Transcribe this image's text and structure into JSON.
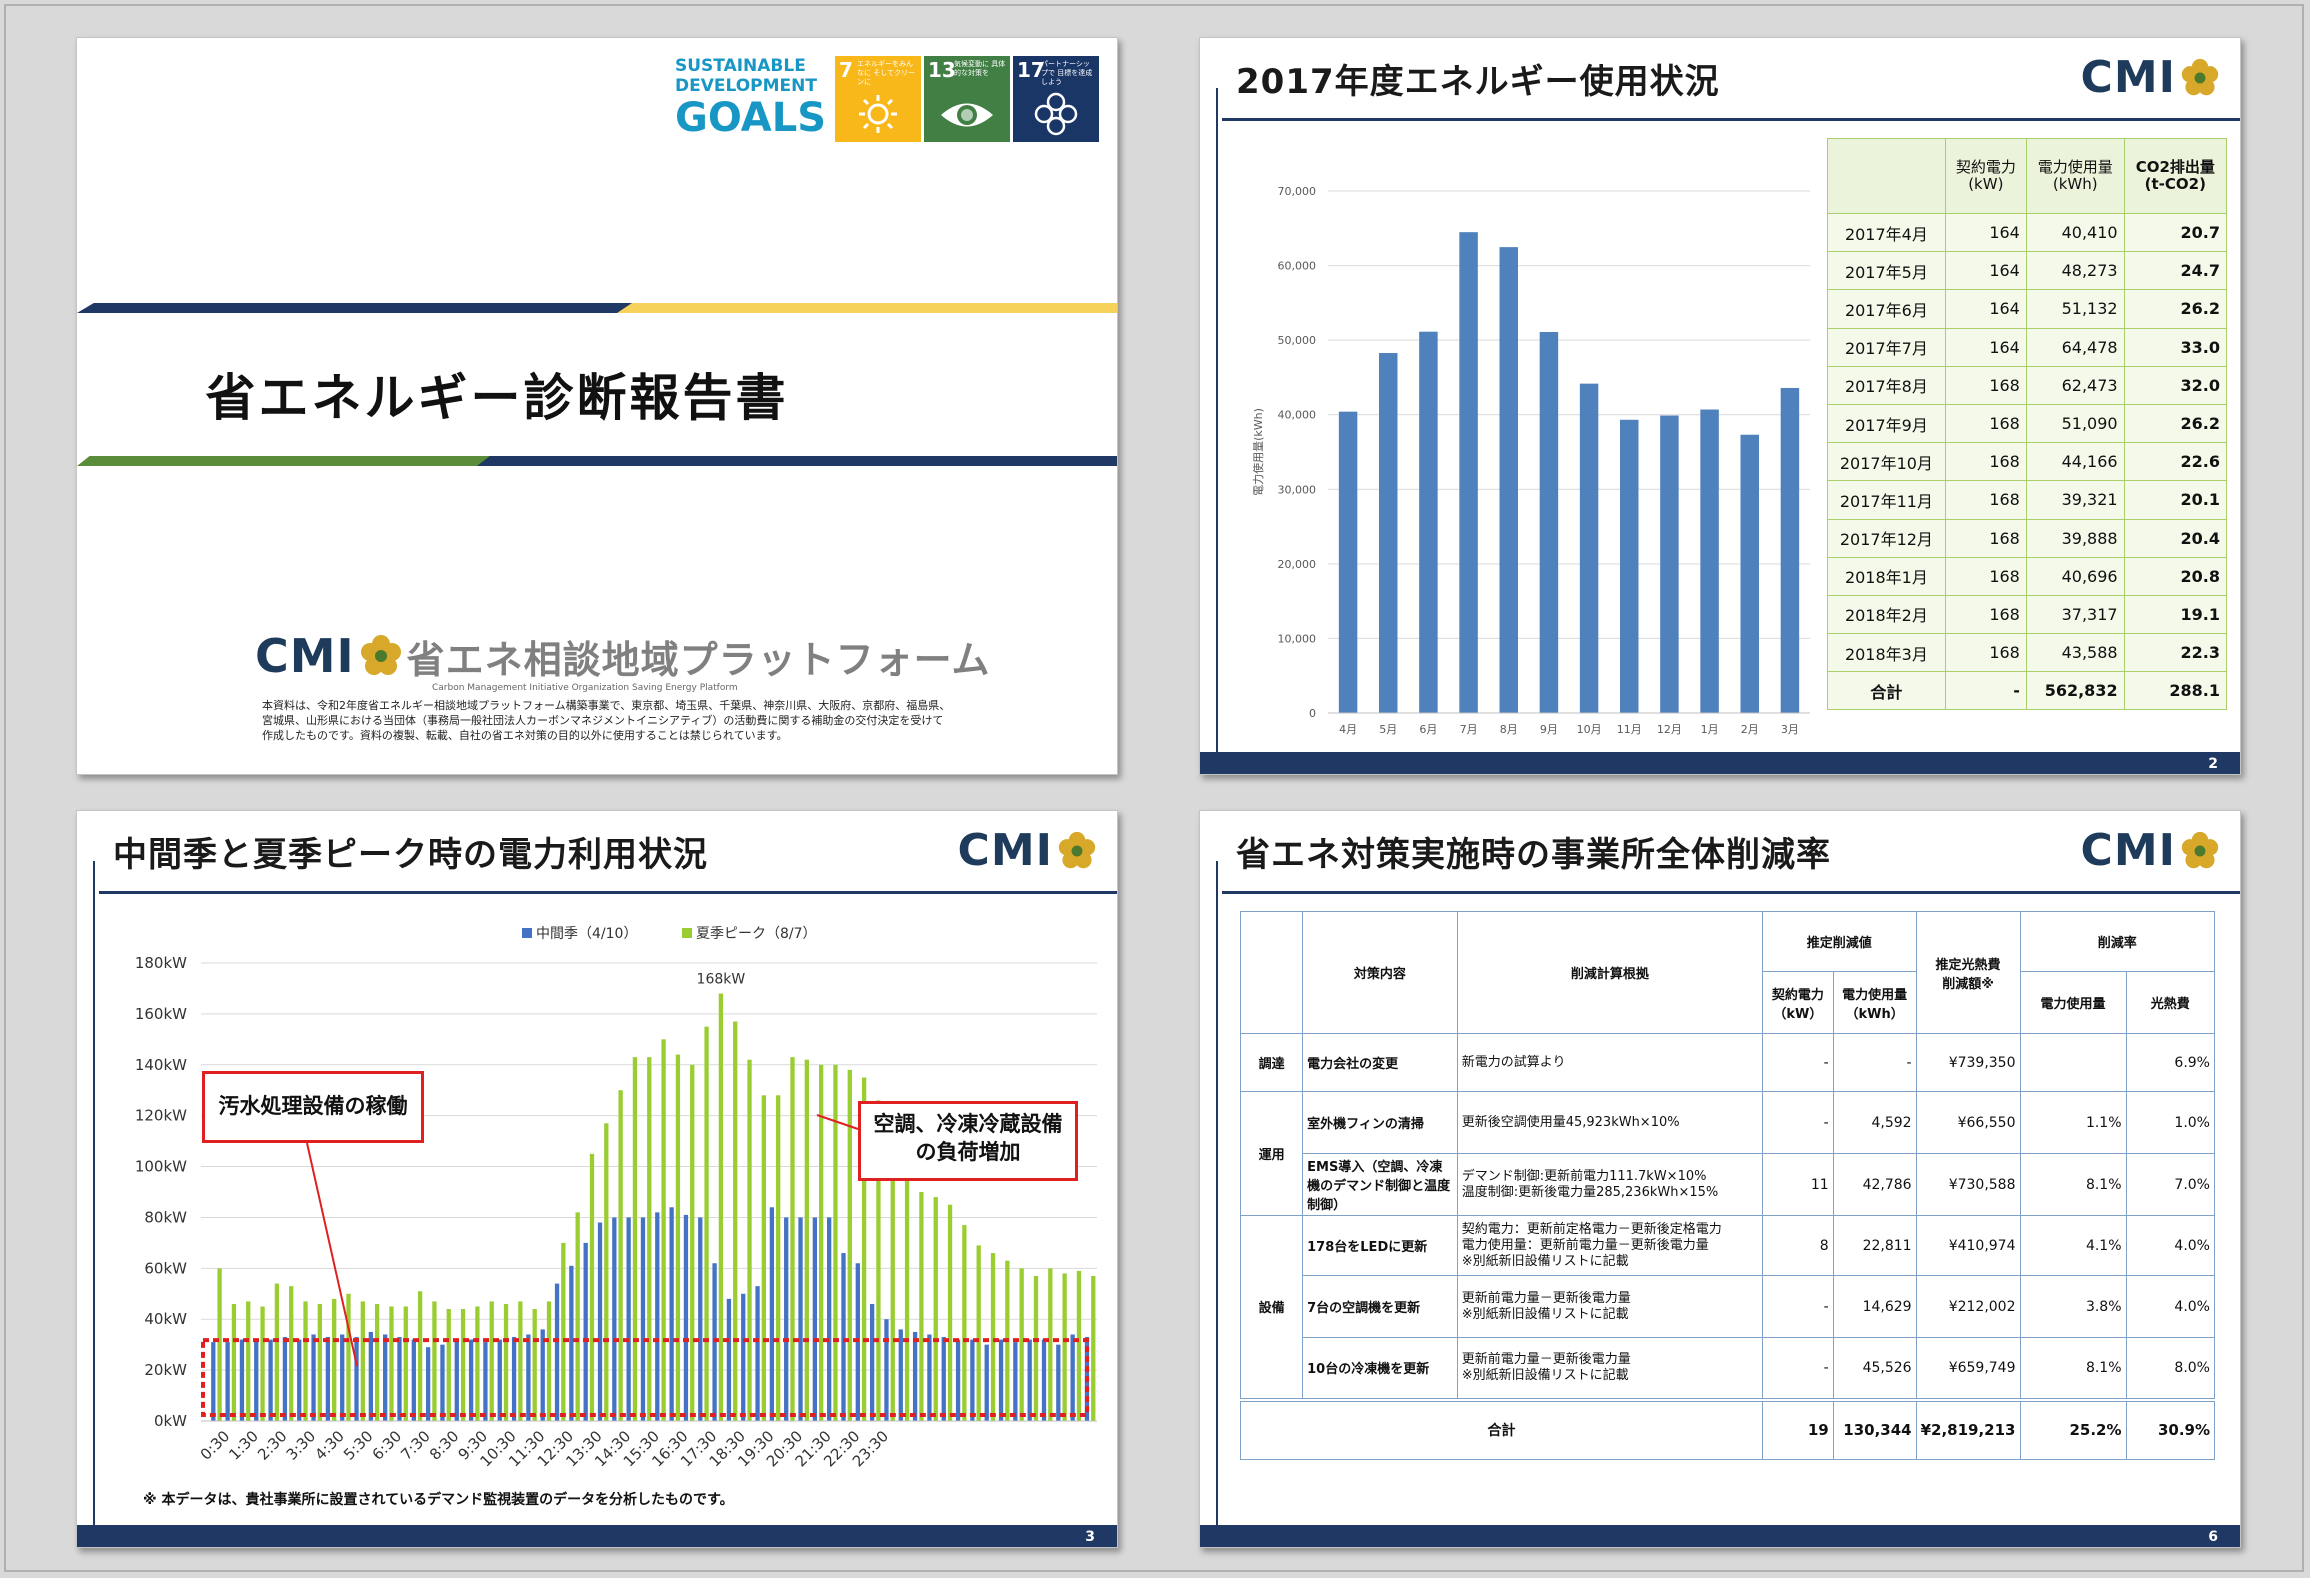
{
  "slide1": {
    "sdg_logo_lines": [
      "SUSTAINABLE",
      "DEVELOPMENT",
      "GOALS"
    ],
    "sdg_tiles": [
      {
        "num": "7",
        "text": "エネルギーをみんなに そしてクリーンに",
        "color": "#f8b81a"
      },
      {
        "num": "13",
        "text": "気候変動に 具体的な対策を",
        "color": "#417f45"
      },
      {
        "num": "17",
        "text": "パートナーシップで 目標を達成しよう",
        "color": "#1a3667"
      }
    ],
    "title": "省エネルギー診断報告書",
    "cmi_logo": "CMI",
    "platform_name": "省エネ相談地域プラットフォーム",
    "platform_sub": "Carbon Management Initiative Organization Saving Energy Platform",
    "disclaimer": "本資料は、令和2年度省エネルギー相談地域プラットフォーム構築事業で、東京都、埼玉県、千葉県、神奈川県、大阪府、京都府、福島県、宮城県、山形県における当団体（事務局一般社団法人カーボンマネジメントイニシアティブ）の活動費に関する補助金の交付決定を受けて作成したものです。資料の複製、転載、自社の省エネ対策の目的以外に使用することは禁じられています。"
  },
  "slide2": {
    "title": "2017年度エネルギー使用状況",
    "logo": "CMI",
    "page": "2",
    "table_headers": [
      "",
      "契約電力\n(kW)",
      "電力使用量\n(kWh)",
      "CO2排出量\n(t-CO2)"
    ],
    "rows": [
      [
        "2017年4月",
        "164",
        "40,410",
        "20.7"
      ],
      [
        "2017年5月",
        "164",
        "48,273",
        "24.7"
      ],
      [
        "2017年6月",
        "164",
        "51,132",
        "26.2"
      ],
      [
        "2017年7月",
        "164",
        "64,478",
        "33.0"
      ],
      [
        "2017年8月",
        "168",
        "62,473",
        "32.0"
      ],
      [
        "2017年9月",
        "168",
        "51,090",
        "26.2"
      ],
      [
        "2017年10月",
        "168",
        "44,166",
        "22.6"
      ],
      [
        "2017年11月",
        "168",
        "39,321",
        "20.1"
      ],
      [
        "2017年12月",
        "168",
        "39,888",
        "20.4"
      ],
      [
        "2018年1月",
        "168",
        "40,696",
        "20.8"
      ],
      [
        "2018年2月",
        "168",
        "37,317",
        "19.1"
      ],
      [
        "2018年3月",
        "168",
        "43,588",
        "22.3"
      ]
    ],
    "total_row": [
      "合計",
      "-",
      "562,832",
      "288.1"
    ]
  },
  "slide3": {
    "title": "中間季と夏季ピーク時の電力利用状況",
    "logo": "CMI",
    "page": "3",
    "callout_left": "汚水処理設備の稼働",
    "callout_right_lines": [
      "空調、冷凍冷蔵設備",
      "の負荷増加"
    ],
    "note": "※ 本データは、貴社事業所に設置されているデマンド監視装置のデータを分析したものです。"
  },
  "slide4": {
    "title": "省エネ対策実施時の事業所全体削減率",
    "logo": "CMI",
    "page": "6",
    "headers": {
      "measure": "対策内容",
      "basis": "削減計算根拠",
      "est_reduction": "推定削減値",
      "contract": "契約電力\n（kW）",
      "usage": "電力使用量\n（kWh）",
      "cost": "推定光熱費\n削減額※",
      "rate": "削減率",
      "rate_power": "電力使用量",
      "rate_cost": "光熱費"
    },
    "groups": [
      {
        "category": "調達",
        "rows": [
          {
            "measure": "電力会社の変更",
            "basis": "新電力の試算より",
            "kw": "-",
            "kwh": "-",
            "cost": "¥739,350",
            "rate_power": "",
            "rate_cost": "6.9%"
          }
        ]
      },
      {
        "category": "運用",
        "rows": [
          {
            "measure": "室外機フィンの清掃",
            "basis": "更新後空調使用量45,923kWh×10%",
            "kw": "-",
            "kwh": "4,592",
            "cost": "¥66,550",
            "rate_power": "1.1%",
            "rate_cost": "1.0%"
          },
          {
            "measure": "EMS導入（空調、冷凍機のデマンド制御と温度制御）",
            "basis": "デマンド制御:更新前電力111.7kW×10%\n温度制御:更新後電力量285,236kWh×15%",
            "kw": "11",
            "kwh": "42,786",
            "cost": "¥730,588",
            "rate_power": "8.1%",
            "rate_cost": "7.0%"
          }
        ]
      },
      {
        "category": "設備",
        "rows": [
          {
            "measure": "178台をLEDに更新",
            "basis": "契約電力：更新前定格電力－更新後定格電力\n電力使用量：更新前電力量－更新後電力量\n※別紙新旧設備リストに記載",
            "kw": "8",
            "kwh": "22,811",
            "cost": "¥410,974",
            "rate_power": "4.1%",
            "rate_cost": "4.0%"
          },
          {
            "measure": "7台の空調機を更新",
            "basis": "更新前電力量－更新後電力量\n※別紙新旧設備リストに記載",
            "kw": "-",
            "kwh": "14,629",
            "cost": "¥212,002",
            "rate_power": "3.8%",
            "rate_cost": "4.0%"
          },
          {
            "measure": "10台の冷凍機を更新",
            "basis": "更新前電力量－更新後電力量\n※別紙新旧設備リストに記載",
            "kw": "-",
            "kwh": "45,526",
            "cost": "¥659,749",
            "rate_power": "8.1%",
            "rate_cost": "8.0%"
          }
        ]
      }
    ],
    "total": {
      "label": "合計",
      "kw": "19",
      "kwh": "130,344",
      "cost": "¥2,819,213",
      "rate_power": "25.2%",
      "rate_cost": "30.9%"
    }
  },
  "chart_data": [
    {
      "type": "bar",
      "title": "",
      "ylabel": "電力使用量(kWh)",
      "xlabel": "",
      "ylim": [
        0,
        70000
      ],
      "yticks": [
        "0",
        "10,000",
        "20,000",
        "30,000",
        "40,000",
        "50,000",
        "60,000",
        "70,000"
      ],
      "categories": [
        "4月",
        "5月",
        "6月",
        "7月",
        "8月",
        "9月",
        "10月",
        "11月",
        "12月",
        "1月",
        "2月",
        "3月"
      ],
      "values": [
        40410,
        48273,
        51132,
        64478,
        62473,
        51090,
        44166,
        39321,
        39888,
        40696,
        37317,
        43588
      ],
      "color": "#4f81bd",
      "grid": true
    },
    {
      "type": "bar",
      "title": "",
      "ylim": [
        0,
        180
      ],
      "yticks": [
        "0kW",
        "20kW",
        "40kW",
        "60kW",
        "80kW",
        "100kW",
        "120kW",
        "140kW",
        "160kW",
        "180kW"
      ],
      "xtick_labels": [
        "0:30",
        "1:30",
        "2:30",
        "3:30",
        "4:30",
        "5:30",
        "6:30",
        "7:30",
        "8:30",
        "9:30",
        "10:30",
        "11:30",
        "12:30",
        "13:30",
        "14:30",
        "15:30",
        "16:30",
        "17:30",
        "18:30",
        "19:30",
        "20:30",
        "21:30",
        "22:30",
        "23:30"
      ],
      "legend_position": "top",
      "peak_label": "168kW",
      "series": [
        {
          "name": "中間季（4/10）",
          "color": "#4472c4",
          "values": [
            31,
            31,
            32,
            32,
            32,
            33,
            32,
            34,
            33,
            34,
            33,
            35,
            34,
            33,
            32,
            29,
            30,
            32,
            32,
            31,
            32,
            33,
            34,
            36,
            54,
            61,
            70,
            78,
            80,
            80,
            80,
            82,
            84,
            81,
            80,
            62,
            48,
            50,
            53,
            84,
            80,
            80,
            80,
            80,
            66,
            62,
            46,
            40,
            36,
            35,
            34,
            33,
            32,
            32,
            30,
            32,
            31,
            32,
            32,
            30,
            34,
            33
          ]
        },
        {
          "name": "夏季ピーク（8/7）",
          "color": "#9acd32",
          "values": [
            60,
            46,
            47,
            45,
            54,
            53,
            47,
            46,
            48,
            50,
            47,
            46,
            45,
            45,
            51,
            47,
            44,
            44,
            45,
            47,
            46,
            47,
            44,
            47,
            70,
            82,
            105,
            117,
            130,
            143,
            143,
            150,
            144,
            140,
            155,
            168,
            157,
            142,
            128,
            128,
            143,
            142,
            140,
            140,
            138,
            135,
            126,
            110,
            97,
            90,
            88,
            85,
            77,
            69,
            66,
            63,
            60,
            57,
            60,
            58,
            59,
            57
          ]
        }
      ]
    }
  ]
}
